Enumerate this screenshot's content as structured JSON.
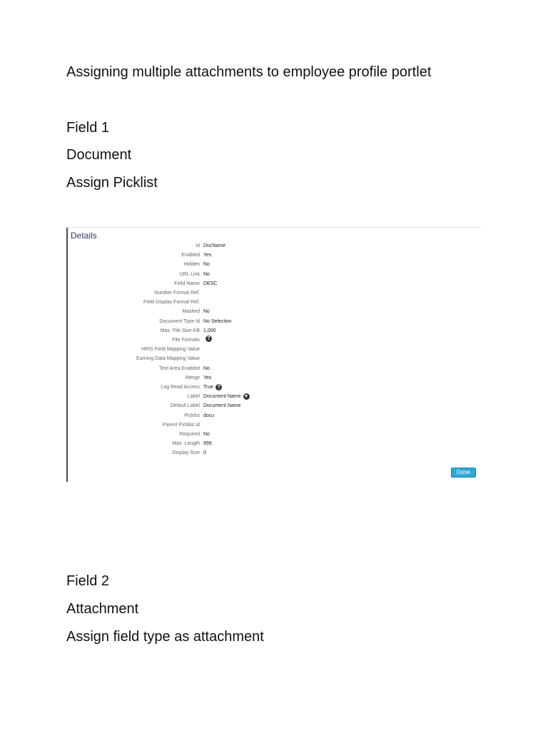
{
  "document": {
    "title": "Assigning multiple attachments to employee profile portlet",
    "field1": {
      "heading": "Field 1",
      "name": "Document",
      "instruction": "Assign Picklist"
    },
    "field2": {
      "heading": "Field 2",
      "name": "Attachment",
      "instruction": "Assign field type as attachment"
    }
  },
  "screenshot": {
    "panel_title": "Details",
    "rows": [
      {
        "label": "Id",
        "value": "DocName",
        "icon": ""
      },
      {
        "label": "Enabled",
        "value": "Yes",
        "icon": ""
      },
      {
        "label": "Hidden",
        "value": "No",
        "icon": ""
      },
      {
        "label": "URL Link",
        "value": "No",
        "icon": ""
      },
      {
        "label": "Field Name",
        "value": "DESC",
        "icon": ""
      },
      {
        "label": "Number Format Ref.",
        "value": "",
        "icon": ""
      },
      {
        "label": "Field Display Format Ref.",
        "value": "",
        "icon": ""
      },
      {
        "label": "Masked",
        "value": "No",
        "icon": ""
      },
      {
        "label": "Document Type Id",
        "value": "No Selection",
        "icon": ""
      },
      {
        "label": "Max. File Size KB",
        "value": "1,000",
        "icon": ""
      },
      {
        "label": "File Formats",
        "value": "",
        "icon": "help-icon"
      },
      {
        "label": "HRIS Field Mapping Value",
        "value": "",
        "icon": ""
      },
      {
        "label": "Earning Data Mapping Value",
        "value": "",
        "icon": ""
      },
      {
        "label": "Text Area Enabled",
        "value": "No",
        "icon": ""
      },
      {
        "label": "Merge",
        "value": "Yes",
        "icon": ""
      },
      {
        "label": "Log Read Access",
        "value": "True",
        "icon": "help-icon"
      },
      {
        "label": "Label",
        "value": "Document Name",
        "icon": "filter-icon"
      },
      {
        "label": "Default Label",
        "value": "Document Name",
        "icon": ""
      },
      {
        "label": "Picklist",
        "value": "docu",
        "icon": ""
      },
      {
        "label": "Parent Picklist Id",
        "value": "",
        "icon": ""
      },
      {
        "label": "Required",
        "value": "No",
        "icon": ""
      },
      {
        "label": "Max. Length",
        "value": "999",
        "icon": ""
      },
      {
        "label": "Display Size",
        "value": "0",
        "icon": ""
      }
    ],
    "done_label": "Done"
  }
}
